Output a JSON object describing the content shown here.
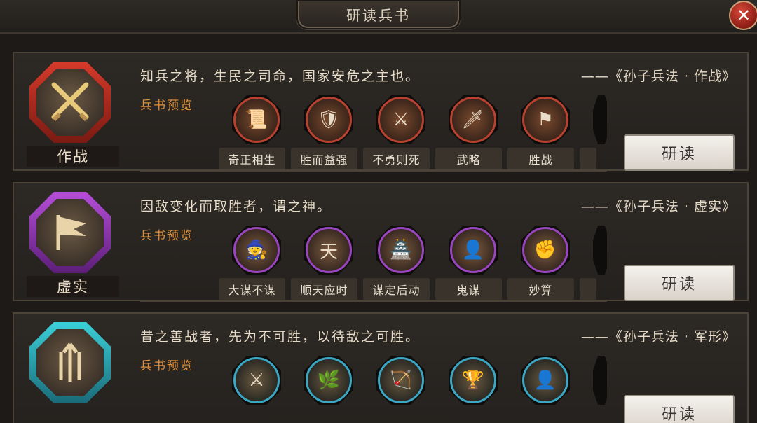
{
  "window": {
    "title": "研读兵书",
    "close_icon": "close-icon"
  },
  "common": {
    "preview_label": "兵书预览",
    "read_label": "研读"
  },
  "books": [
    {
      "name": "作战",
      "theme": "red",
      "emblem_icon": "crossed-swords-icon",
      "quote": "知兵之将，生民之司命，国家安危之主也。",
      "source": "——《孙子兵法 · 作战》",
      "skills": [
        "奇正相生",
        "胜而益强",
        "不勇则死",
        "武略",
        "胜战"
      ]
    },
    {
      "name": "虚实",
      "theme": "purple",
      "emblem_icon": "war-banner-icon",
      "quote": "因敌变化而取胜者，谓之神。",
      "source": "——《孙子兵法 · 虚实》",
      "skills": [
        "大谋不谋",
        "顺天应时",
        "谋定后动",
        "鬼谋",
        "妙算"
      ]
    },
    {
      "name": "",
      "theme": "blue",
      "emblem_icon": "formation-arrows-icon",
      "quote": "昔之善战者，先为不可胜，以待敌之可胜。",
      "source": "——《孙子兵法 · 军形》",
      "skills": []
    }
  ]
}
